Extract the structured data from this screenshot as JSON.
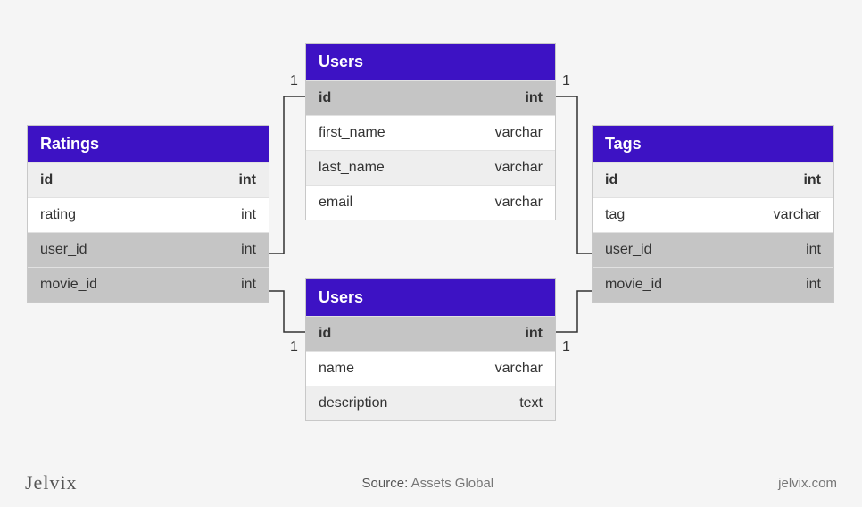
{
  "brand": "Jelvix",
  "source_label": "Source:",
  "source_value": "Assets Global",
  "site": "jelvix.com",
  "tables": {
    "ratings": {
      "title": "Ratings",
      "rows": [
        {
          "name": "id",
          "type": "int",
          "bold": true,
          "shade": "alt"
        },
        {
          "name": "rating",
          "type": "int",
          "bold": false,
          "shade": ""
        },
        {
          "name": "user_id",
          "type": "int",
          "bold": false,
          "shade": "dark"
        },
        {
          "name": "movie_id",
          "type": "int",
          "bold": false,
          "shade": "dark"
        }
      ]
    },
    "users_top": {
      "title": "Users",
      "rows": [
        {
          "name": "id",
          "type": "int",
          "bold": true,
          "shade": "dark"
        },
        {
          "name": "first_name",
          "type": "varchar",
          "bold": false,
          "shade": ""
        },
        {
          "name": "last_name",
          "type": "varchar",
          "bold": false,
          "shade": "alt"
        },
        {
          "name": "email",
          "type": "varchar",
          "bold": false,
          "shade": ""
        }
      ]
    },
    "users_bottom": {
      "title": "Users",
      "rows": [
        {
          "name": "id",
          "type": "int",
          "bold": true,
          "shade": "dark"
        },
        {
          "name": "name",
          "type": "varchar",
          "bold": false,
          "shade": ""
        },
        {
          "name": "description",
          "type": "text",
          "bold": false,
          "shade": "alt"
        }
      ]
    },
    "tags": {
      "title": "Tags",
      "rows": [
        {
          "name": "id",
          "type": "int",
          "bold": true,
          "shade": "alt"
        },
        {
          "name": "tag",
          "type": "varchar",
          "bold": false,
          "shade": ""
        },
        {
          "name": "user_id",
          "type": "int",
          "bold": false,
          "shade": "dark"
        },
        {
          "name": "movie_id",
          "type": "int",
          "bold": false,
          "shade": "dark"
        }
      ]
    }
  },
  "cardinalities": {
    "c1": "1",
    "c2": "1",
    "c3": "1",
    "c4": "1"
  }
}
